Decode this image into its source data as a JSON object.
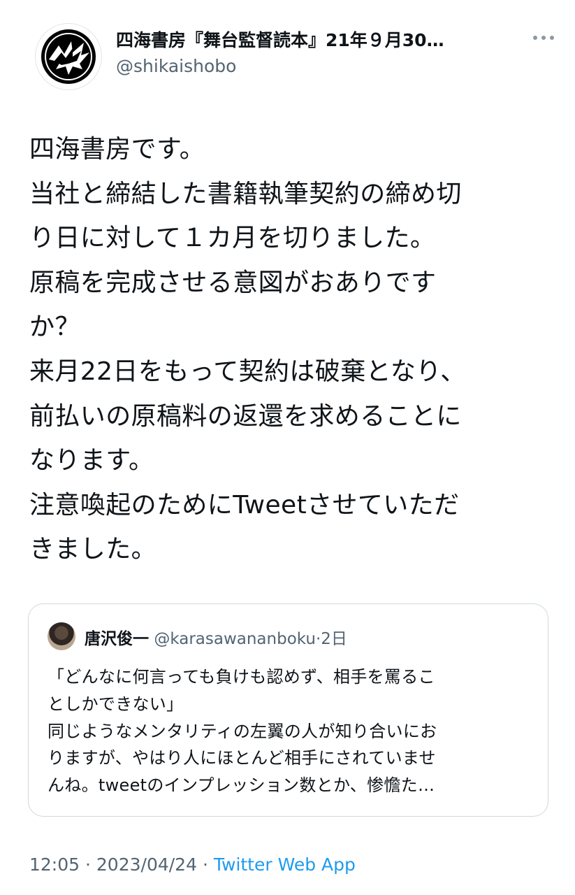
{
  "author": {
    "display_name": "四海書房『舞台監督読本』21年９月30…",
    "handle": "@shikaishobo",
    "avatar_icon": "crow-logo-icon"
  },
  "more_icon": "more-horizontal-icon",
  "tweet": {
    "lines": [
      "四海書房です。",
      "当社と締結した書籍執筆契約の締め切",
      "り日に対して１カ月を切りました。",
      "原稿を完成させる意図がおありです",
      "か？",
      "来月22日をもって契約は破棄となり、",
      "前払いの原稿料の返還を求めることに",
      "なります。",
      "注意喚起のためにTweetさせていただ",
      "きました。"
    ]
  },
  "quoted": {
    "display_name": "唐沢俊一",
    "handle": "@karasawananboku",
    "separator": "·",
    "time": "2日",
    "lines": [
      "「どんなに何言っても負けも認めず、相手を罵るこ",
      "としかできない」",
      "同じようなメンタリティの左翼の人が知り合いにお",
      "りますが、やはり人にほとんど相手にされていませ",
      "んね。tweetのインプレッション数とか、惨憺た…"
    ]
  },
  "meta": {
    "time": "12:05",
    "date": "2023/04/24",
    "separator": "·",
    "source": "Twitter Web App"
  }
}
